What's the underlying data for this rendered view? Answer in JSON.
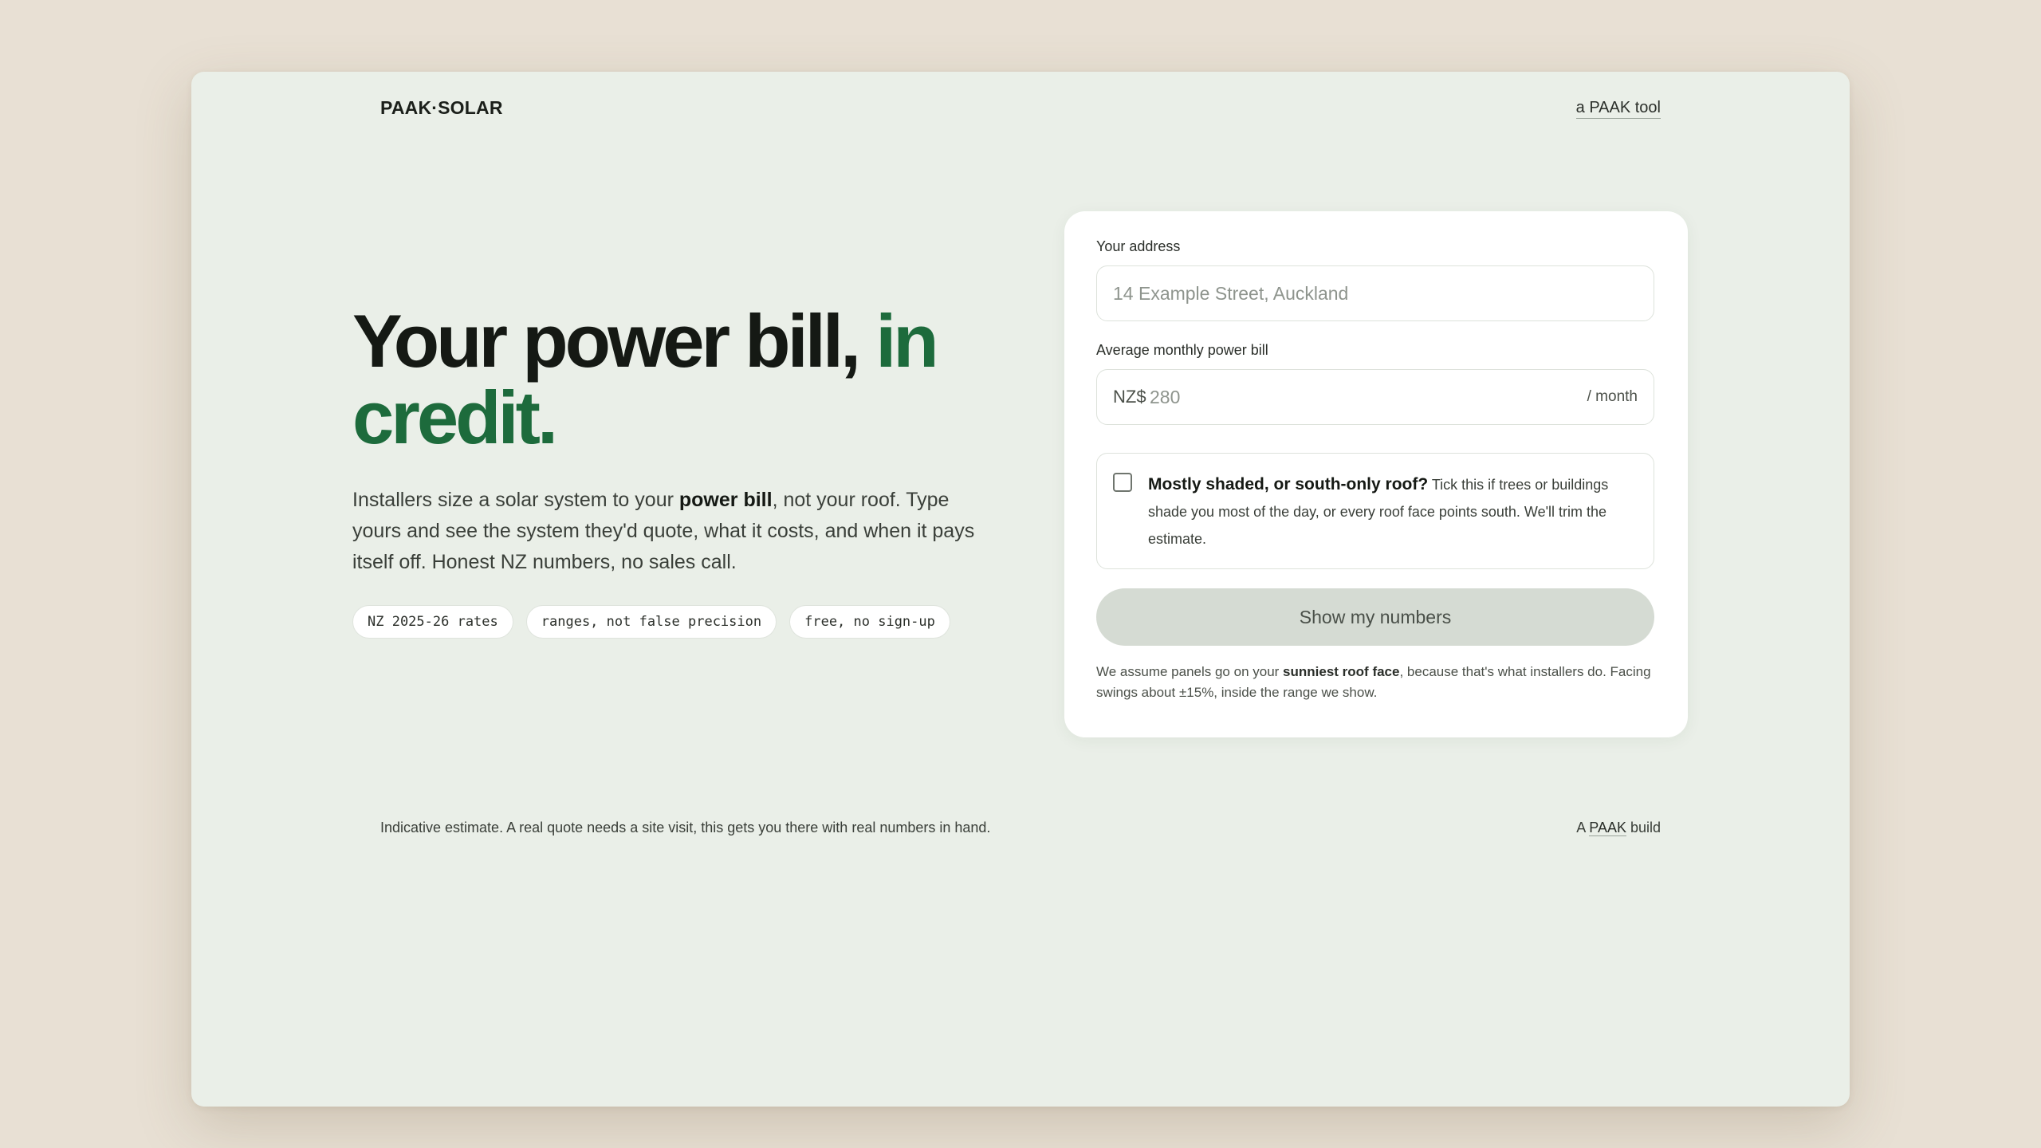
{
  "header": {
    "logo_left": "PAAK",
    "logo_dot": "·",
    "logo_right": "SOLAR",
    "top_link": "a PAAK tool"
  },
  "hero": {
    "headline_main": "Your power bill, ",
    "headline_accent": "in credit.",
    "lede_1": "Installers size a solar system to your ",
    "lede_bold": "power bill",
    "lede_2": ", not your roof. Type yours and see the system they'd quote, what it costs, and when it pays itself off. Honest NZ numbers, no sales call.",
    "chips": [
      "NZ 2025-26 rates",
      "ranges, not false precision",
      "free, no sign-up"
    ]
  },
  "form": {
    "address_label": "Your address",
    "address_placeholder": "14 Example Street, Auckland",
    "bill_label": "Average monthly power bill",
    "bill_currency": "NZ$",
    "bill_placeholder": "280",
    "bill_suffix": "/ month",
    "shade_title": "Mostly shaded, or south-only roof?",
    "shade_desc": " Tick this if trees or buildings shade you most of the day, or every roof face points south. We'll trim the estimate.",
    "shade_checked": false,
    "submit_label": "Show my numbers",
    "note_1": "We assume panels go on your ",
    "note_bold": "sunniest roof face",
    "note_2": ", because that's what installers do. Facing swings about ±15%, inside the range we show."
  },
  "footer": {
    "disclaimer": "Indicative estimate. A real quote needs a site visit, this gets you there with real numbers in hand.",
    "credit_prefix": "A ",
    "credit_link": "PAAK",
    "credit_suffix": " build"
  },
  "colors": {
    "accent": "#1d6b3c",
    "page_bg": "#e8e0d4",
    "window_bg": "#eaefe8"
  }
}
